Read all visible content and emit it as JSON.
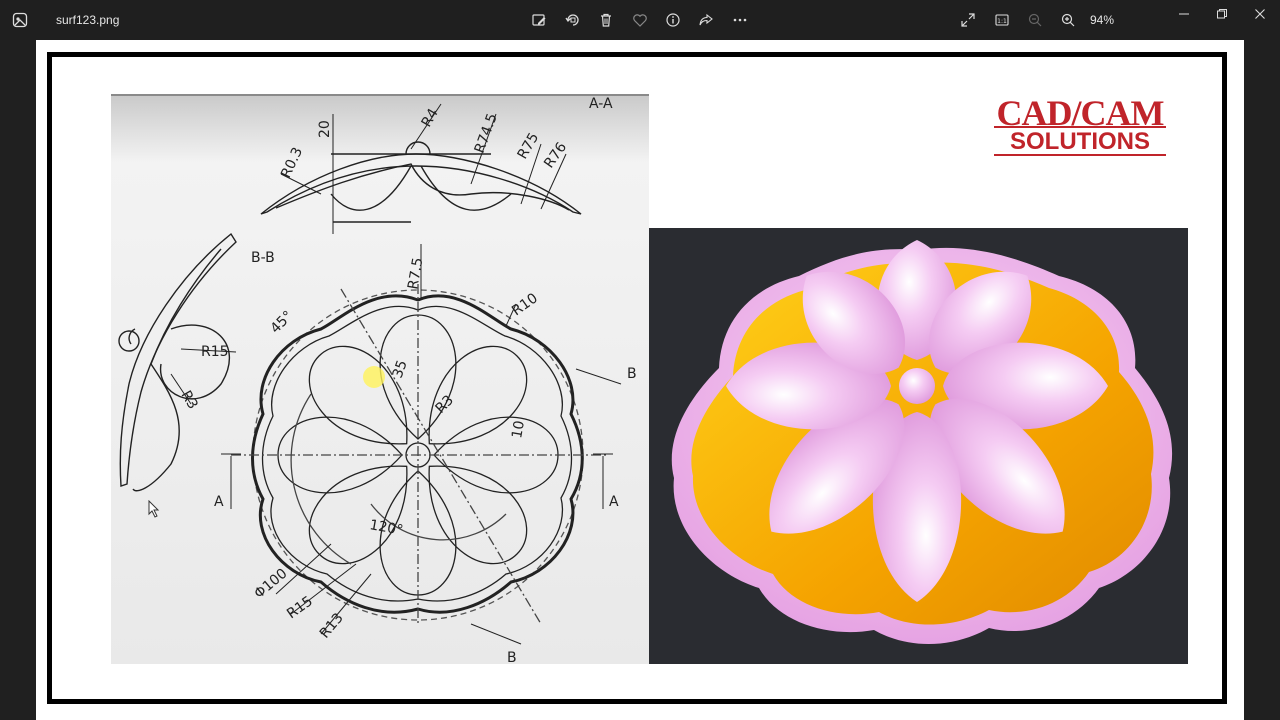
{
  "window": {
    "file_name": "surf123.png",
    "zoom": "94%",
    "zoom_level": 94
  },
  "toolbar": {
    "icons": [
      "edit-image-icon",
      "rotate-icon",
      "delete-icon",
      "favorite-icon",
      "info-icon",
      "share-icon",
      "more-icon"
    ],
    "right_icons": [
      "fullscreen-icon",
      "actual-size-icon",
      "zoom-out-icon",
      "zoom-in-icon"
    ]
  },
  "brand": {
    "line1": "CAD/CAM",
    "line2": "SOLUTIONS",
    "color": "#c0242a"
  },
  "drawing": {
    "section_aa": "A-A",
    "section_bb": "B-B",
    "dims": {
      "r03": "R0.3",
      "d20": "20",
      "r4": "R4",
      "r745": "R74.5",
      "r75": "R75",
      "r76": "R76",
      "r75b": "R7.5",
      "r10": "R10",
      "r15": "R15",
      "r3": "R3",
      "a45": "45°",
      "d35": "35",
      "r3b": "R3",
      "d10": "10",
      "a120": "120°",
      "phi100": "Φ100",
      "r15b": "R15",
      "r13": "R13",
      "label_a": "A",
      "label_b": "B"
    }
  },
  "render": {
    "background": "#2a2c31",
    "petal_color": "#f0bff0",
    "base_color": "#f5a300",
    "rim_color": "#efb8ec"
  }
}
